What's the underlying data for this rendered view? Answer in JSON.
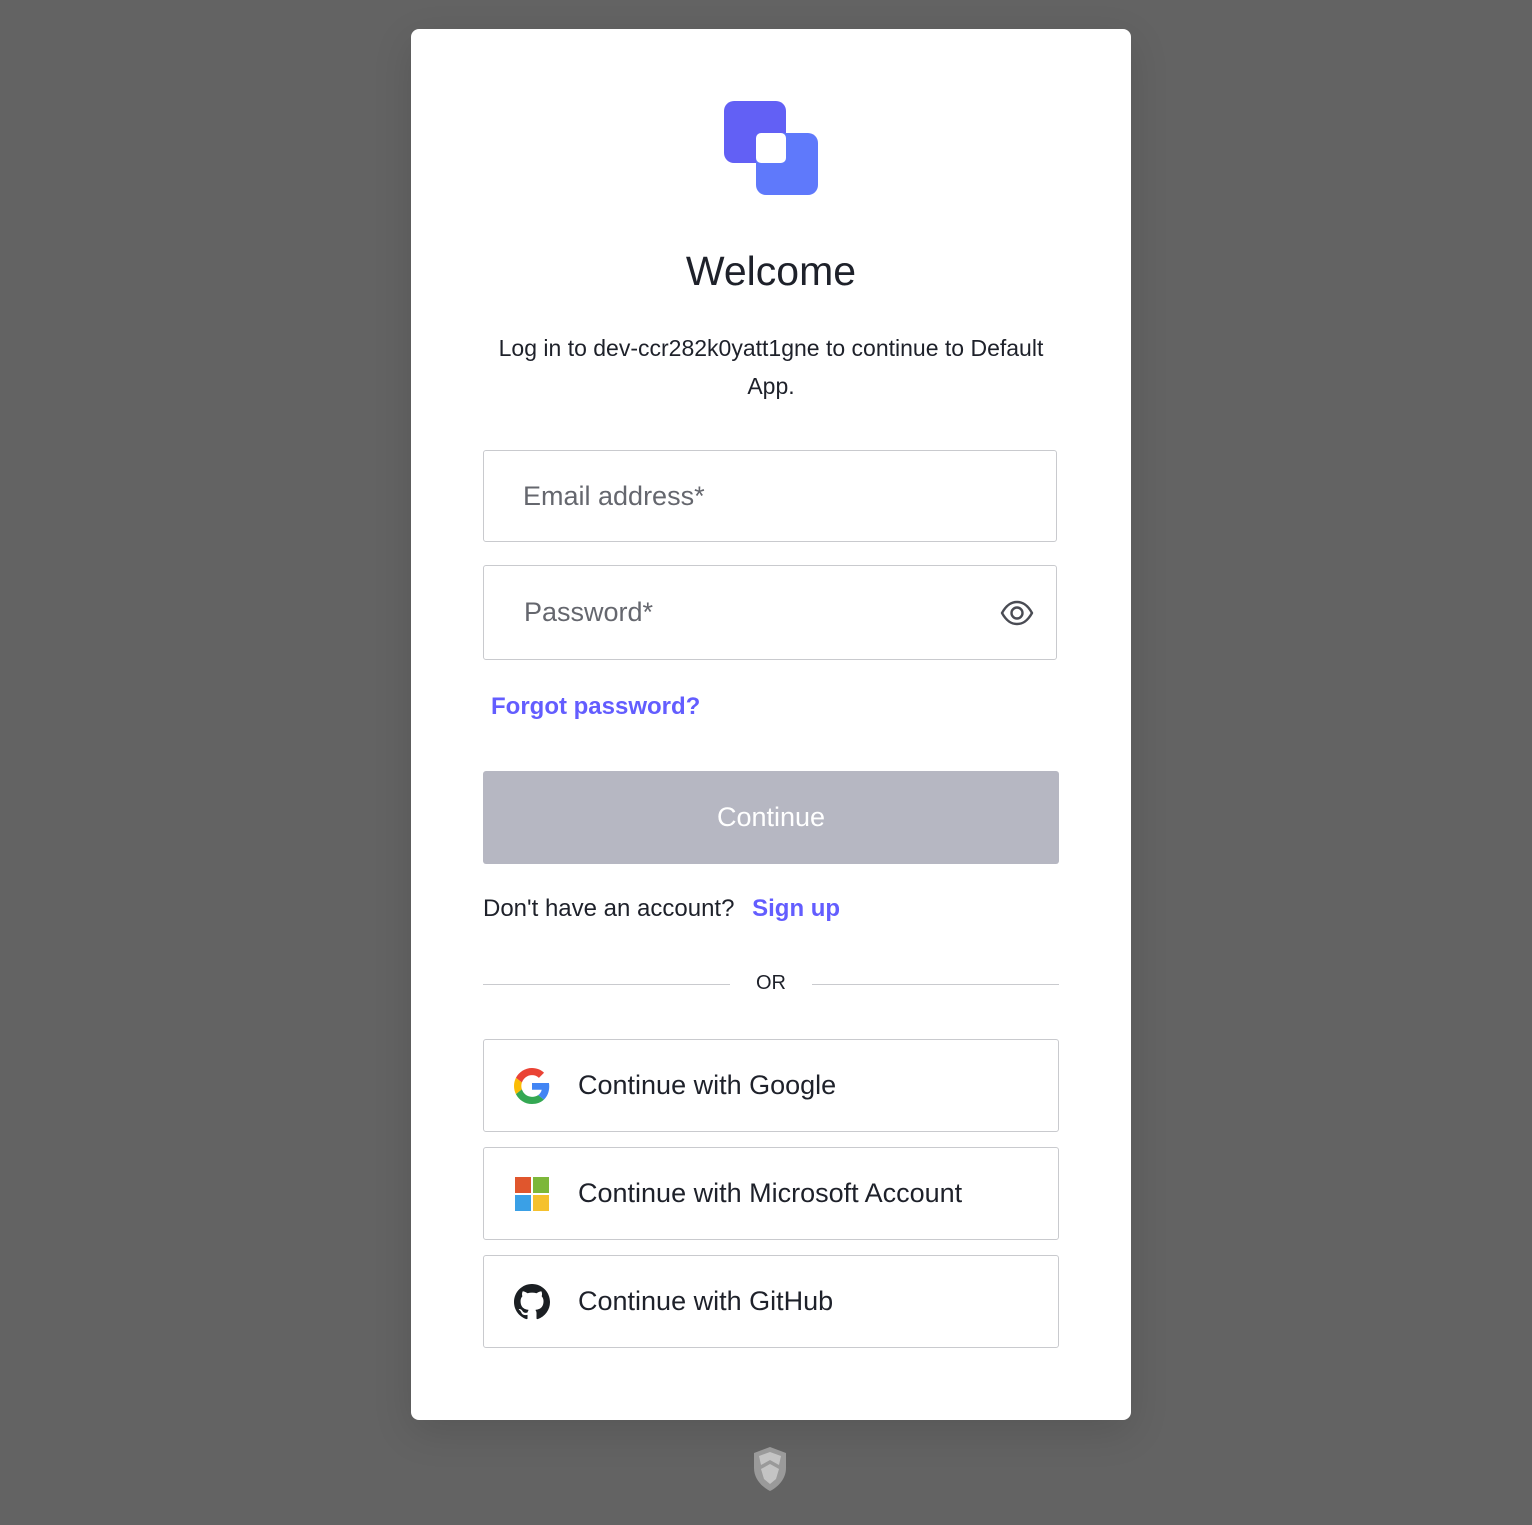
{
  "colors": {
    "page_background": "#636363",
    "card_background": "#ffffff",
    "accent": "#635dff",
    "disabled_button": "#b6b7c2",
    "text": "#1e212a",
    "border": "#c9cace"
  },
  "login": {
    "logo_icon": "app-logo-icon",
    "title": "Welcome",
    "subtitle": "Log in to dev-ccr282k0yatt1gne to continue to Default App.",
    "email": {
      "value": "",
      "placeholder": "Email address*"
    },
    "password": {
      "value": "",
      "placeholder": "Password*",
      "toggle_icon": "eye-icon"
    },
    "forgot_password_label": "Forgot password?",
    "continue_label": "Continue",
    "signup_prompt": "Don't have an account?",
    "signup_label": "Sign up",
    "divider_label": "OR"
  },
  "social": [
    {
      "label": "Continue with Google",
      "icon": "google-icon"
    },
    {
      "label": "Continue with Microsoft Account",
      "icon": "microsoft-icon"
    },
    {
      "label": "Continue with GitHub",
      "icon": "github-icon"
    }
  ],
  "footer": {
    "icon": "shield-badge-icon"
  }
}
